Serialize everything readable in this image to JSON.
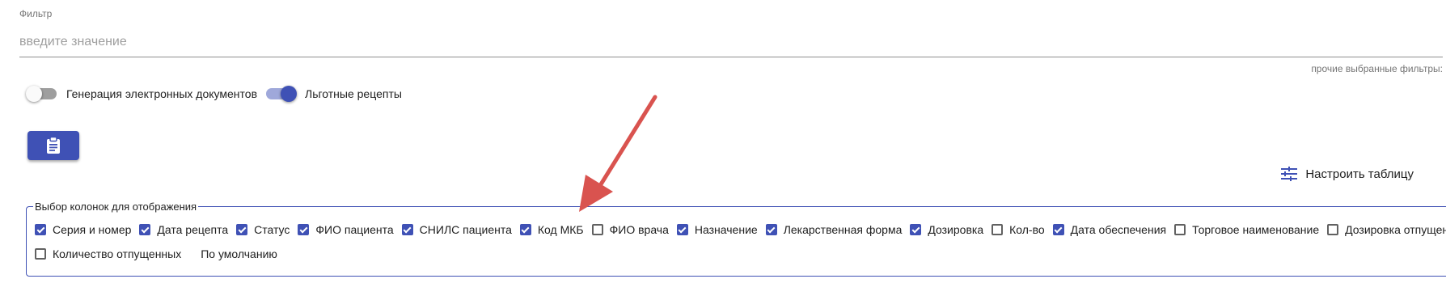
{
  "filter": {
    "label": "Фильтр",
    "placeholder": "введите значение",
    "value": "",
    "other_filters": "прочие выбранные фильтры:"
  },
  "toggles": [
    {
      "label": "Генерация электронных документов",
      "on": false
    },
    {
      "label": "Льготные рецепты",
      "on": true
    }
  ],
  "action_button": {
    "icon": "clipboard-icon"
  },
  "configure_table": {
    "label": "Настроить таблицу",
    "icon": "tune-icon"
  },
  "columns": {
    "legend": "Выбор колонок для отображения",
    "items": [
      {
        "label": "Серия и номер",
        "checked": true
      },
      {
        "label": "Дата рецепта",
        "checked": true
      },
      {
        "label": "Статус",
        "checked": true
      },
      {
        "label": "ФИО пациента",
        "checked": true
      },
      {
        "label": "СНИЛС пациента",
        "checked": true
      },
      {
        "label": "Код МКБ",
        "checked": true
      },
      {
        "label": "ФИО врача",
        "checked": false
      },
      {
        "label": "Назначение",
        "checked": true
      },
      {
        "label": "Лекарственная форма",
        "checked": true
      },
      {
        "label": "Дозировка",
        "checked": true
      },
      {
        "label": "Кол-во",
        "checked": false
      },
      {
        "label": "Дата обеспечения",
        "checked": true
      },
      {
        "label": "Торговое наименование",
        "checked": false
      },
      {
        "label": "Дозировка отпущенных",
        "checked": false
      },
      {
        "label": "Количество отпущенных",
        "checked": false
      }
    ],
    "default_label": "По умолчанию"
  },
  "colors": {
    "accent": "#3f51b5",
    "annotation_arrow": "#d9534f"
  }
}
